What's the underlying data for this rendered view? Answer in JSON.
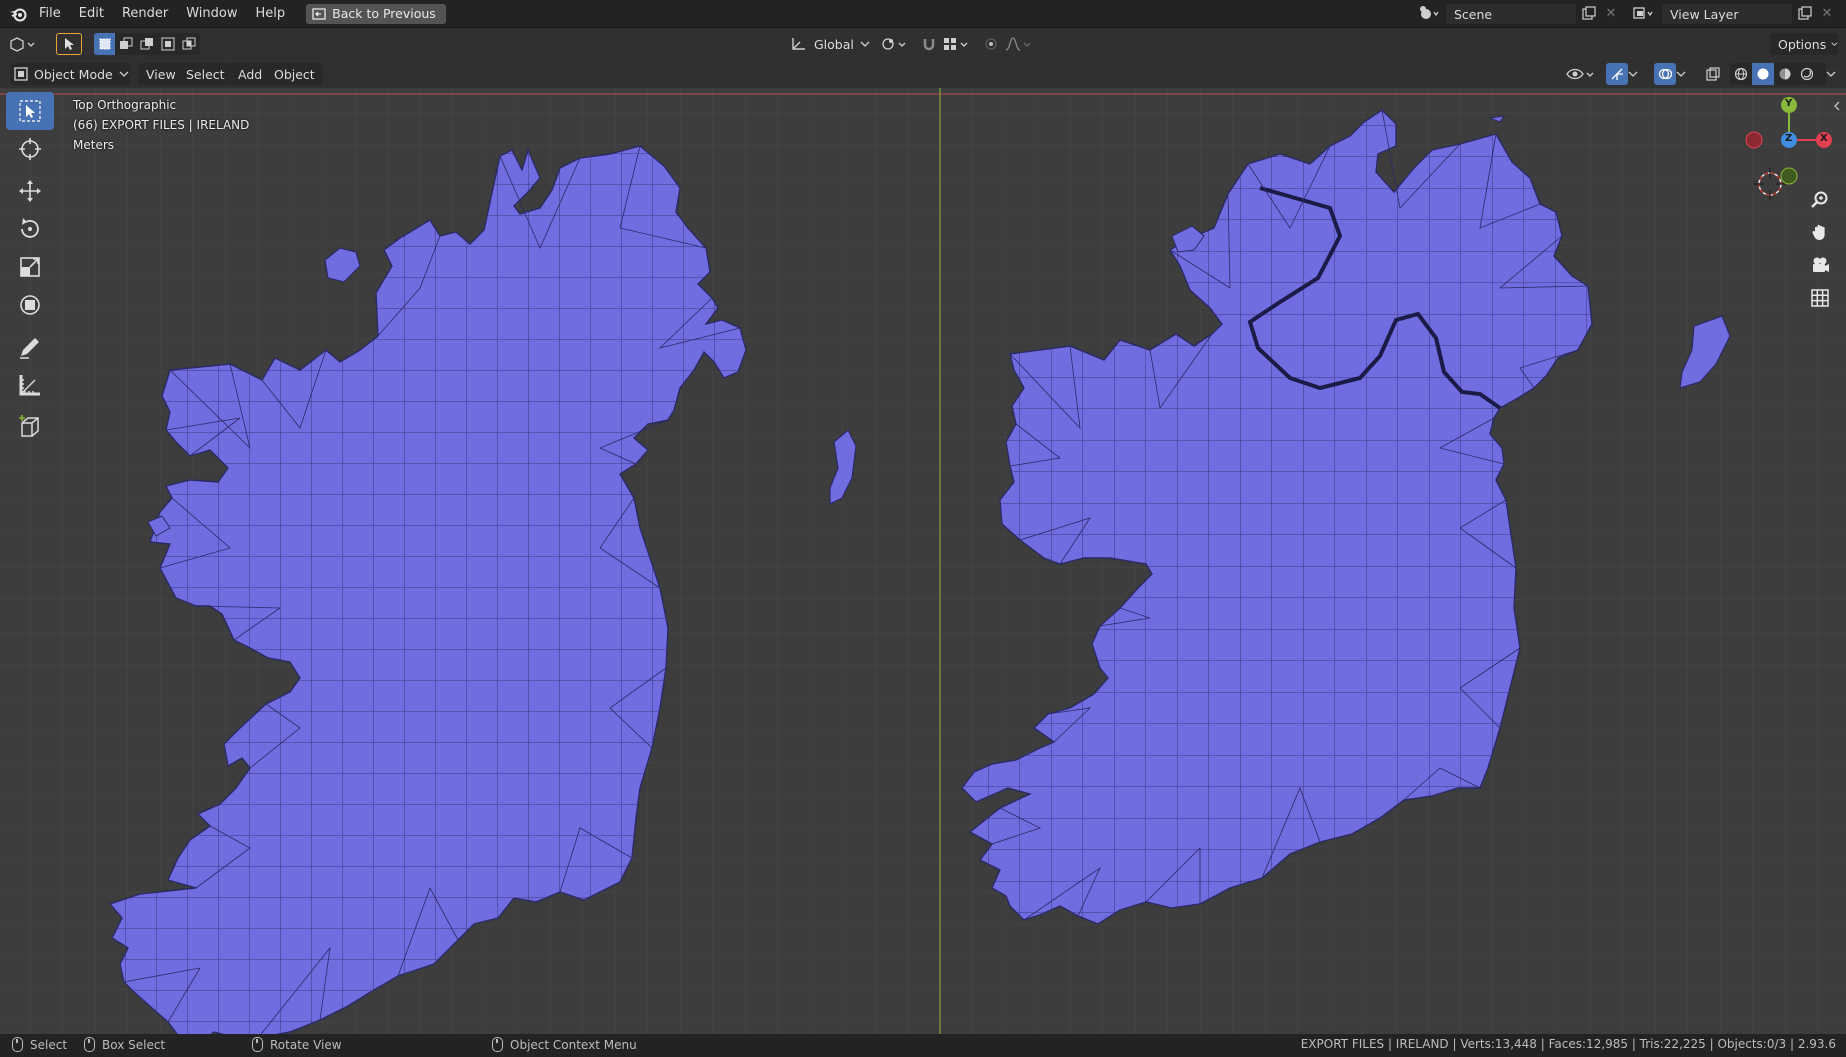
{
  "menu": {
    "items": [
      "File",
      "Edit",
      "Render",
      "Window",
      "Help"
    ],
    "back_label": "Back to Previous"
  },
  "scene": {
    "label": "Scene"
  },
  "view_layer": {
    "label": "View Layer"
  },
  "tool_header": {
    "orientation": "Global",
    "options_label": "Options"
  },
  "view_header": {
    "mode": "Object Mode",
    "menus": [
      "View",
      "Select",
      "Add",
      "Object"
    ]
  },
  "viewport": {
    "view_name": "Top Orthographic",
    "collection": "(66) EXPORT FILES | IRELAND",
    "units": "Meters",
    "gizmo_axes": [
      "Y",
      "Z",
      "X"
    ]
  },
  "statusbar": {
    "select": "Select",
    "box_select": "Box Select",
    "rotate_view": "Rotate View",
    "context_menu": "Object Context Menu",
    "stats": "EXPORT FILES | IRELAND | Verts:13,448 | Faces:12,985 | Tris:22,225 | Objects:0/3 | 2.93.6"
  },
  "colors": {
    "mesh_fill": "#6f6de0",
    "accent": "#4772b3",
    "axis_x": "#e04050",
    "axis_y": "#89b83a",
    "axis_z": "#3f8ce0"
  }
}
